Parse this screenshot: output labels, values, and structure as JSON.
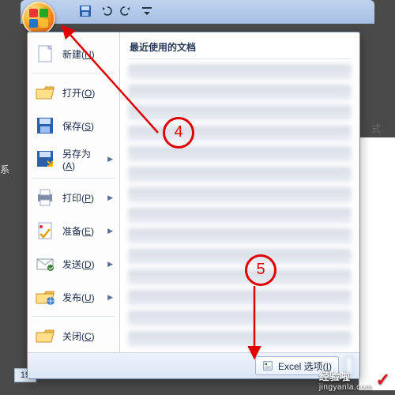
{
  "background": {
    "left_text": "系",
    "right_text": "式",
    "row_label": "19"
  },
  "office_menu": {
    "recent_title": "最近使用的文档",
    "items": [
      {
        "label": "新建",
        "accel": "N",
        "arrow": false,
        "icon": "new"
      },
      {
        "label": "打开",
        "accel": "O",
        "arrow": false,
        "icon": "open"
      },
      {
        "label": "保存",
        "accel": "S",
        "arrow": false,
        "icon": "save"
      },
      {
        "label": "另存为",
        "accel": "A",
        "arrow": true,
        "icon": "saveas"
      },
      {
        "label": "打印",
        "accel": "P",
        "arrow": true,
        "icon": "print"
      },
      {
        "label": "准备",
        "accel": "E",
        "arrow": true,
        "icon": "prepare"
      },
      {
        "label": "发送",
        "accel": "D",
        "arrow": true,
        "icon": "send"
      },
      {
        "label": "发布",
        "accel": "U",
        "arrow": true,
        "icon": "publish"
      },
      {
        "label": "关闭",
        "accel": "C",
        "arrow": false,
        "icon": "close"
      }
    ],
    "options_button": "Excel 选项",
    "options_accel": "I"
  },
  "annotations": {
    "step4": "4",
    "step5": "5"
  },
  "watermark": {
    "name": "经验啦",
    "domain": "jingyanla.com"
  }
}
